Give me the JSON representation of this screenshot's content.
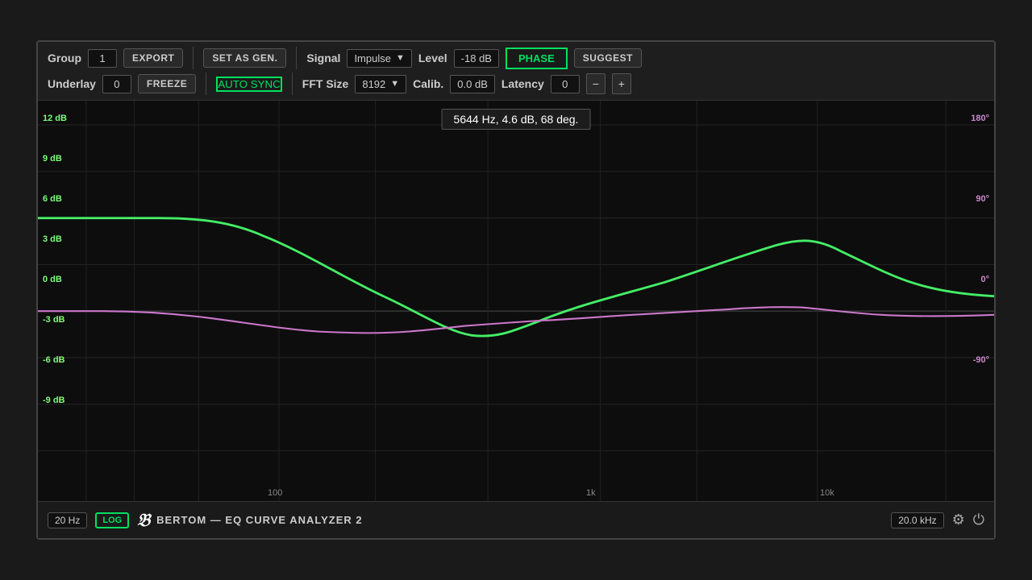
{
  "plugin": {
    "title": "BERTOM — EQ CURVE ANALYZER 2"
  },
  "controls": {
    "group_label": "Group",
    "group_value": "1",
    "export_label": "EXPORT",
    "set_as_gen_label": "SET AS GEN.",
    "signal_label": "Signal",
    "signal_value": "Impulse",
    "level_label": "Level",
    "level_value": "-18 dB",
    "phase_label": "PHASE",
    "suggest_label": "SUGGEST",
    "underlay_label": "Underlay",
    "underlay_value": "0",
    "freeze_label": "FREEZE",
    "auto_sync_label": "AUTO SYNC",
    "fft_label": "FFT Size",
    "fft_value": "8192",
    "calib_label": "Calib.",
    "calib_value": "0.0 dB",
    "latency_label": "Latency",
    "latency_value": "0",
    "minus_label": "−",
    "plus_label": "+"
  },
  "chart": {
    "tooltip": "5644 Hz, 4.6 dB, 68 deg.",
    "y_labels_left": [
      "12 dB",
      "9 dB",
      "6 dB",
      "3 dB",
      "0 dB",
      "-3 dB",
      "-6 dB",
      "-9 dB"
    ],
    "y_labels_right": [
      "180°",
      "90°",
      "0°",
      "-90°"
    ],
    "x_labels": [
      "100",
      "1k",
      "10k"
    ]
  },
  "footer": {
    "freq_min": "20 Hz",
    "freq_max": "20.0 kHz",
    "log_label": "LOG",
    "brand_symbol": "𝔅",
    "brand_text": "BERTOM — EQ CURVE ANALYZER 2"
  }
}
